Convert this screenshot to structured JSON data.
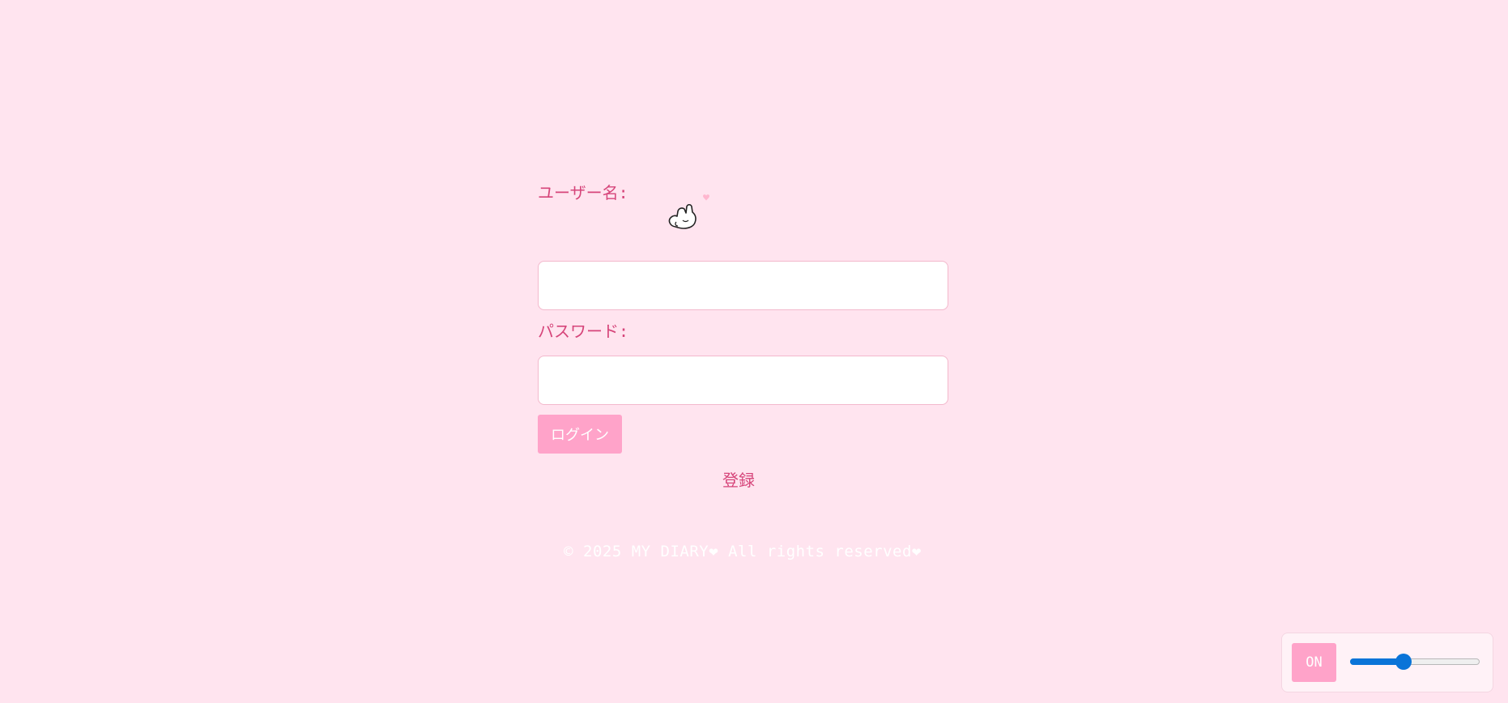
{
  "login_form": {
    "username_label": "ユーザー名:",
    "password_label": "パスワード:",
    "username_value": "",
    "password_value": "",
    "login_button_label": "ログイン",
    "mascot_icon": "rabbit-icon",
    "heart_icon": "heart-icon"
  },
  "register_link_label": "登録",
  "footer_text": "© 2025 MY DIARY❤ All rights reserved❤",
  "control_panel": {
    "toggle_label": "ON",
    "slider_value_fraction": 0.41
  },
  "colors": {
    "page_background": "#ffe4ef",
    "accent_text": "#d6457a",
    "button_pink": "#ffa3c9",
    "slider_blue": "#0a74d8"
  }
}
